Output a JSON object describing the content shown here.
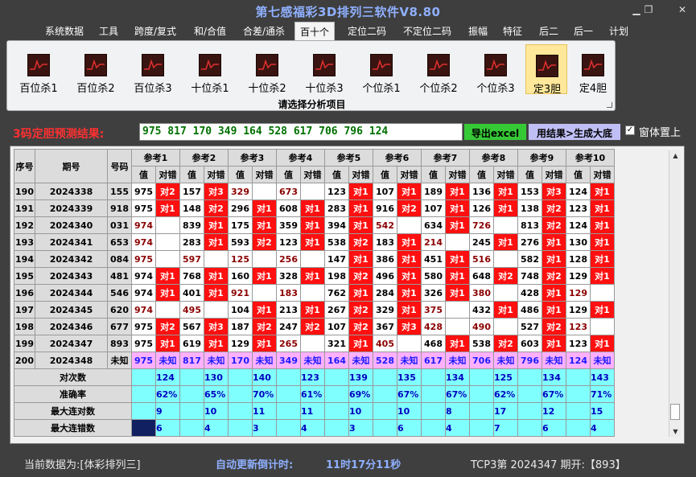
{
  "window": {
    "title": "第七感福彩3D排列三软件V8.80",
    "min_icon": "minimize-icon",
    "max_icon": "maximize-icon",
    "close_icon": "close-icon"
  },
  "menu": [
    {
      "label": "系统数据",
      "active": false
    },
    {
      "label": "工具",
      "active": false
    },
    {
      "label": "跨度/复式",
      "active": false
    },
    {
      "label": "和/合值",
      "active": false
    },
    {
      "label": "合差/通杀",
      "active": false
    },
    {
      "label": "百十个",
      "active": true
    },
    {
      "label": "定位二码",
      "active": false
    },
    {
      "label": "不定位二码",
      "active": false
    },
    {
      "label": "振幅",
      "active": false
    },
    {
      "label": "特征",
      "active": false
    },
    {
      "label": "后二",
      "active": false
    },
    {
      "label": "后一",
      "active": false
    },
    {
      "label": "计划",
      "active": false
    }
  ],
  "ribbon": {
    "caption": "请选择分析项目",
    "buttons": [
      {
        "label": "百位杀1",
        "icon": "chart-icon",
        "selected": false
      },
      {
        "label": "百位杀2",
        "icon": "chart-icon",
        "selected": false
      },
      {
        "label": "百位杀3",
        "icon": "chart-icon",
        "selected": false
      },
      {
        "label": "十位杀1",
        "icon": "chart-icon",
        "selected": false
      },
      {
        "label": "十位杀2",
        "icon": "chart-icon",
        "selected": false
      },
      {
        "label": "十位杀3",
        "icon": "chart-icon",
        "selected": false
      },
      {
        "label": "个位杀1",
        "icon": "chart-icon",
        "selected": false
      },
      {
        "label": "个位杀2",
        "icon": "chart-icon",
        "selected": false
      },
      {
        "label": "个位杀3",
        "icon": "chart-icon",
        "selected": false
      },
      {
        "label": "定3胆",
        "icon": "chart-icon",
        "selected": true
      },
      {
        "label": "定4胆",
        "icon": "chart-icon",
        "selected": false
      }
    ]
  },
  "prediction": {
    "label": "3码定胆预测结果:",
    "value": "975 817 170 349 164 528 617 706 796 124"
  },
  "buttons": {
    "export": "导出excel",
    "generate": "用结果>生成大底"
  },
  "checkbox": {
    "label": "窗体置上",
    "checked": true,
    "mark": "✓"
  },
  "table": {
    "headers": {
      "seq": "序号",
      "period": "期号",
      "code": "号码",
      "refs": [
        "参考1",
        "参考2",
        "参考3",
        "参考4",
        "参考5",
        "参考6",
        "参考7",
        "参考8",
        "参考9",
        "参考10"
      ],
      "val": "值",
      "res": "对错"
    },
    "rows": [
      {
        "seq": "190",
        "period": "2024338",
        "code": "155",
        "cells": [
          [
            "975",
            "对2"
          ],
          [
            "157",
            "对3"
          ],
          [
            "329",
            ""
          ],
          [
            "673",
            ""
          ],
          [
            "123",
            "对1"
          ],
          [
            "107",
            "对1"
          ],
          [
            "189",
            "对1"
          ],
          [
            "136",
            "对1"
          ],
          [
            "153",
            "对3"
          ],
          [
            "124",
            "对1"
          ]
        ]
      },
      {
        "seq": "191",
        "period": "2024339",
        "code": "918",
        "cells": [
          [
            "975",
            "对1"
          ],
          [
            "148",
            "对2"
          ],
          [
            "296",
            "对1"
          ],
          [
            "608",
            "对1"
          ],
          [
            "283",
            "对1"
          ],
          [
            "916",
            "对2"
          ],
          [
            "107",
            "对1"
          ],
          [
            "126",
            "对1"
          ],
          [
            "138",
            "对2"
          ],
          [
            "123",
            "对1"
          ]
        ]
      },
      {
        "seq": "192",
        "period": "2024340",
        "code": "031",
        "cells": [
          [
            "974",
            ""
          ],
          [
            "839",
            "对1"
          ],
          [
            "175",
            "对1"
          ],
          [
            "359",
            "对1"
          ],
          [
            "394",
            "对1"
          ],
          [
            "542",
            ""
          ],
          [
            "634",
            "对1"
          ],
          [
            "726",
            ""
          ],
          [
            "813",
            "对2"
          ],
          [
            "124",
            "对1"
          ]
        ]
      },
      {
        "seq": "193",
        "period": "2024341",
        "code": "653",
        "cells": [
          [
            "974",
            ""
          ],
          [
            "283",
            "对1"
          ],
          [
            "593",
            "对2"
          ],
          [
            "123",
            "对1"
          ],
          [
            "538",
            "对2"
          ],
          [
            "183",
            "对1"
          ],
          [
            "214",
            ""
          ],
          [
            "245",
            "对1"
          ],
          [
            "276",
            "对1"
          ],
          [
            "130",
            "对1"
          ]
        ]
      },
      {
        "seq": "194",
        "period": "2024342",
        "code": "084",
        "cells": [
          [
            "975",
            ""
          ],
          [
            "597",
            ""
          ],
          [
            "125",
            ""
          ],
          [
            "256",
            ""
          ],
          [
            "147",
            "对1"
          ],
          [
            "386",
            "对1"
          ],
          [
            "451",
            "对1"
          ],
          [
            "516",
            ""
          ],
          [
            "582",
            "对1"
          ],
          [
            "128",
            "对1"
          ]
        ]
      },
      {
        "seq": "195",
        "period": "2024343",
        "code": "481",
        "cells": [
          [
            "974",
            "对1"
          ],
          [
            "768",
            "对1"
          ],
          [
            "160",
            "对1"
          ],
          [
            "328",
            "对1"
          ],
          [
            "198",
            "对2"
          ],
          [
            "496",
            "对1"
          ],
          [
            "580",
            "对1"
          ],
          [
            "648",
            "对2"
          ],
          [
            "748",
            "对2"
          ],
          [
            "129",
            "对1"
          ]
        ]
      },
      {
        "seq": "196",
        "period": "2024344",
        "code": "546",
        "cells": [
          [
            "974",
            "对1"
          ],
          [
            "401",
            "对1"
          ],
          [
            "921",
            ""
          ],
          [
            "183",
            ""
          ],
          [
            "762",
            "对1"
          ],
          [
            "284",
            "对1"
          ],
          [
            "326",
            "对1"
          ],
          [
            "380",
            ""
          ],
          [
            "428",
            "对1"
          ],
          [
            "129",
            ""
          ]
        ]
      },
      {
        "seq": "197",
        "period": "2024345",
        "code": "620",
        "cells": [
          [
            "974",
            ""
          ],
          [
            "495",
            ""
          ],
          [
            "104",
            "对1"
          ],
          [
            "213",
            "对1"
          ],
          [
            "267",
            "对2"
          ],
          [
            "329",
            "对1"
          ],
          [
            "375",
            ""
          ],
          [
            "432",
            "对1"
          ],
          [
            "486",
            "对1"
          ],
          [
            "129",
            "对1"
          ]
        ]
      },
      {
        "seq": "198",
        "period": "2024346",
        "code": "677",
        "cells": [
          [
            "975",
            "对2"
          ],
          [
            "567",
            "对3"
          ],
          [
            "187",
            "对2"
          ],
          [
            "247",
            "对2"
          ],
          [
            "107",
            "对2"
          ],
          [
            "367",
            "对3"
          ],
          [
            "428",
            ""
          ],
          [
            "490",
            ""
          ],
          [
            "527",
            "对2"
          ],
          [
            "123",
            ""
          ]
        ]
      },
      {
        "seq": "199",
        "period": "2024347",
        "code": "893",
        "cells": [
          [
            "975",
            "对1"
          ],
          [
            "619",
            "对1"
          ],
          [
            "129",
            "对1"
          ],
          [
            "265",
            ""
          ],
          [
            "321",
            "对1"
          ],
          [
            "405",
            ""
          ],
          [
            "468",
            "对1"
          ],
          [
            "538",
            "对2"
          ],
          [
            "603",
            "对1"
          ],
          [
            "123",
            "对1"
          ]
        ]
      }
    ],
    "pending": {
      "seq": "200",
      "period": "2024348",
      "code": "未知",
      "cells": [
        [
          "975",
          "未知"
        ],
        [
          "817",
          "未知"
        ],
        [
          "170",
          "未知"
        ],
        [
          "349",
          "未知"
        ],
        [
          "164",
          "未知"
        ],
        [
          "528",
          "未知"
        ],
        [
          "617",
          "未知"
        ],
        [
          "706",
          "未知"
        ],
        [
          "796",
          "未知"
        ],
        [
          "124",
          "未知"
        ]
      ]
    },
    "stats": [
      {
        "label": "对次数",
        "values": [
          "124",
          "130",
          "140",
          "123",
          "139",
          "135",
          "134",
          "125",
          "134",
          "143"
        ]
      },
      {
        "label": "准确率",
        "values": [
          "62%",
          "65%",
          "70%",
          "61%",
          "69%",
          "67%",
          "67%",
          "62%",
          "67%",
          "71%"
        ]
      },
      {
        "label": "最大连对数",
        "values": [
          "9",
          "10",
          "11",
          "11",
          "10",
          "10",
          "8",
          "17",
          "12",
          "15"
        ]
      },
      {
        "label": "最大连错数",
        "values": [
          "6",
          "4",
          "3",
          "4",
          "3",
          "6",
          "4",
          "7",
          "6",
          "4"
        ]
      }
    ]
  },
  "status": {
    "current_label": "当前数据为:[体彩排列三]",
    "countdown_label": "自动更新倒计时:",
    "countdown_value": "11时17分11秒",
    "period_info": "TCP3第 2024347 期开:【893】"
  }
}
